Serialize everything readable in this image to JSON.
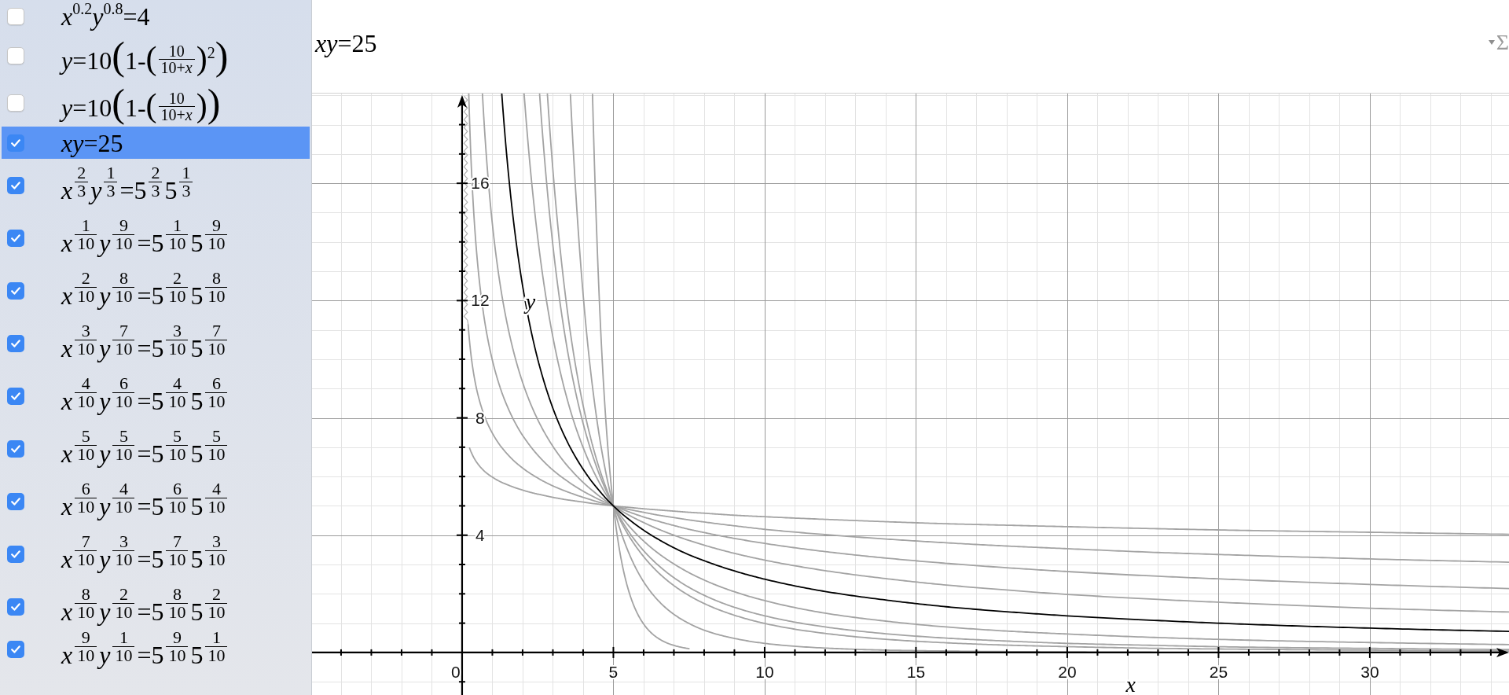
{
  "sidebar": {
    "equations": [
      {
        "checked": false,
        "selected": false,
        "parts": [
          {
            "kind": "text",
            "text": "*x*"
          },
          {
            "kind": "sup",
            "text": "0.2"
          },
          {
            "kind": "text",
            "text": "*y*"
          },
          {
            "kind": "sup",
            "text": "0.8"
          },
          {
            "kind": "text",
            "text": "=4"
          }
        ]
      },
      {
        "checked": false,
        "selected": false,
        "parts": [
          {
            "kind": "text",
            "text": "*y*=10"
          },
          {
            "kind": "bigparen",
            "text": "("
          },
          {
            "kind": "text",
            "text": "1-"
          },
          {
            "kind": "paren",
            "text": "("
          },
          {
            "kind": "frac",
            "num": "10",
            "den": "10+*x*"
          },
          {
            "kind": "paren",
            "text": ")"
          },
          {
            "kind": "sup",
            "text": "2"
          },
          {
            "kind": "bigparen",
            "text": ")"
          }
        ]
      },
      {
        "checked": false,
        "selected": false,
        "parts": [
          {
            "kind": "text",
            "text": "*y*=10"
          },
          {
            "kind": "bigparen",
            "text": "("
          },
          {
            "kind": "text",
            "text": "1-"
          },
          {
            "kind": "paren",
            "text": "("
          },
          {
            "kind": "frac",
            "num": "10",
            "den": "10+*x*"
          },
          {
            "kind": "paren",
            "text": ")"
          },
          {
            "kind": "bigparen",
            "text": ")"
          }
        ]
      },
      {
        "checked": true,
        "selected": true,
        "parts": [
          {
            "kind": "text",
            "text": "*xy*=25"
          }
        ]
      },
      {
        "checked": true,
        "selected": false,
        "parts": [
          {
            "kind": "text",
            "text": "*x*"
          },
          {
            "kind": "supfrac",
            "num": "2",
            "den": "3"
          },
          {
            "kind": "text",
            "text": "*y*"
          },
          {
            "kind": "supfrac",
            "num": "1",
            "den": "3"
          },
          {
            "kind": "text",
            "text": "=5"
          },
          {
            "kind": "supfrac",
            "num": "2",
            "den": "3"
          },
          {
            "kind": "text",
            "text": "5"
          },
          {
            "kind": "supfrac",
            "num": "1",
            "den": "3"
          }
        ]
      },
      {
        "checked": true,
        "selected": false,
        "parts": [
          {
            "kind": "text",
            "text": "*x*"
          },
          {
            "kind": "supfrac",
            "num": "1",
            "den": "10"
          },
          {
            "kind": "text",
            "text": "*y*"
          },
          {
            "kind": "supfrac",
            "num": "9",
            "den": "10"
          },
          {
            "kind": "text",
            "text": "=5"
          },
          {
            "kind": "supfrac",
            "num": "1",
            "den": "10"
          },
          {
            "kind": "text",
            "text": "5"
          },
          {
            "kind": "supfrac",
            "num": "9",
            "den": "10"
          }
        ]
      },
      {
        "checked": true,
        "selected": false,
        "parts": [
          {
            "kind": "text",
            "text": "*x*"
          },
          {
            "kind": "supfrac",
            "num": "2",
            "den": "10"
          },
          {
            "kind": "text",
            "text": "*y*"
          },
          {
            "kind": "supfrac",
            "num": "8",
            "den": "10"
          },
          {
            "kind": "text",
            "text": "=5"
          },
          {
            "kind": "supfrac",
            "num": "2",
            "den": "10"
          },
          {
            "kind": "text",
            "text": "5"
          },
          {
            "kind": "supfrac",
            "num": "8",
            "den": "10"
          }
        ]
      },
      {
        "checked": true,
        "selected": false,
        "parts": [
          {
            "kind": "text",
            "text": "*x*"
          },
          {
            "kind": "supfrac",
            "num": "3",
            "den": "10"
          },
          {
            "kind": "text",
            "text": "*y*"
          },
          {
            "kind": "supfrac",
            "num": "7",
            "den": "10"
          },
          {
            "kind": "text",
            "text": "=5"
          },
          {
            "kind": "supfrac",
            "num": "3",
            "den": "10"
          },
          {
            "kind": "text",
            "text": "5"
          },
          {
            "kind": "supfrac",
            "num": "7",
            "den": "10"
          }
        ]
      },
      {
        "checked": true,
        "selected": false,
        "parts": [
          {
            "kind": "text",
            "text": "*x*"
          },
          {
            "kind": "supfrac",
            "num": "4",
            "den": "10"
          },
          {
            "kind": "text",
            "text": "*y*"
          },
          {
            "kind": "supfrac",
            "num": "6",
            "den": "10"
          },
          {
            "kind": "text",
            "text": "=5"
          },
          {
            "kind": "supfrac",
            "num": "4",
            "den": "10"
          },
          {
            "kind": "text",
            "text": "5"
          },
          {
            "kind": "supfrac",
            "num": "6",
            "den": "10"
          }
        ]
      },
      {
        "checked": true,
        "selected": false,
        "parts": [
          {
            "kind": "text",
            "text": "*x*"
          },
          {
            "kind": "supfrac",
            "num": "5",
            "den": "10"
          },
          {
            "kind": "text",
            "text": "*y*"
          },
          {
            "kind": "supfrac",
            "num": "5",
            "den": "10"
          },
          {
            "kind": "text",
            "text": "=5"
          },
          {
            "kind": "supfrac",
            "num": "5",
            "den": "10"
          },
          {
            "kind": "text",
            "text": "5"
          },
          {
            "kind": "supfrac",
            "num": "5",
            "den": "10"
          }
        ]
      },
      {
        "checked": true,
        "selected": false,
        "parts": [
          {
            "kind": "text",
            "text": "*x*"
          },
          {
            "kind": "supfrac",
            "num": "6",
            "den": "10"
          },
          {
            "kind": "text",
            "text": "*y*"
          },
          {
            "kind": "supfrac",
            "num": "4",
            "den": "10"
          },
          {
            "kind": "text",
            "text": "=5"
          },
          {
            "kind": "supfrac",
            "num": "6",
            "den": "10"
          },
          {
            "kind": "text",
            "text": "5"
          },
          {
            "kind": "supfrac",
            "num": "4",
            "den": "10"
          }
        ]
      },
      {
        "checked": true,
        "selected": false,
        "parts": [
          {
            "kind": "text",
            "text": "*x*"
          },
          {
            "kind": "supfrac",
            "num": "7",
            "den": "10"
          },
          {
            "kind": "text",
            "text": "*y*"
          },
          {
            "kind": "supfrac",
            "num": "3",
            "den": "10"
          },
          {
            "kind": "text",
            "text": "=5"
          },
          {
            "kind": "supfrac",
            "num": "7",
            "den": "10"
          },
          {
            "kind": "text",
            "text": "5"
          },
          {
            "kind": "supfrac",
            "num": "3",
            "den": "10"
          }
        ]
      },
      {
        "checked": true,
        "selected": false,
        "parts": [
          {
            "kind": "text",
            "text": "*x*"
          },
          {
            "kind": "supfrac",
            "num": "8",
            "den": "10"
          },
          {
            "kind": "text",
            "text": "*y*"
          },
          {
            "kind": "supfrac",
            "num": "2",
            "den": "10"
          },
          {
            "kind": "text",
            "text": "=5"
          },
          {
            "kind": "supfrac",
            "num": "8",
            "den": "10"
          },
          {
            "kind": "text",
            "text": "5"
          },
          {
            "kind": "supfrac",
            "num": "2",
            "den": "10"
          }
        ]
      },
      {
        "checked": true,
        "selected": false,
        "parts": [
          {
            "kind": "text",
            "text": "*x*"
          },
          {
            "kind": "supfrac",
            "num": "9",
            "den": "10"
          },
          {
            "kind": "text",
            "text": "*y*"
          },
          {
            "kind": "supfrac",
            "num": "1",
            "den": "10"
          },
          {
            "kind": "text",
            "text": "=5"
          },
          {
            "kind": "supfrac",
            "num": "9",
            "den": "10"
          },
          {
            "kind": "text",
            "text": "5"
          },
          {
            "kind": "supfrac",
            "num": "1",
            "den": "10"
          }
        ]
      }
    ]
  },
  "header": {
    "equation": "*xy*=25",
    "format_menu": {
      "label": "Σ"
    }
  },
  "graph": {
    "chart_data": {
      "type": "line",
      "xlabel": "x",
      "ylabel": "y",
      "x": [
        0.2,
        0.2205,
        0.25,
        0.35,
        0.5,
        0.672,
        0.75,
        1,
        1.25,
        1.3117,
        1.5,
        1.75,
        2,
        2.05,
        2.5,
        2.562,
        2.819,
        3,
        3.5,
        3.58,
        4,
        4.25,
        4.31,
        4.5,
        4.75,
        5,
        5.25,
        5.5,
        6,
        6.5,
        7,
        7.5,
        8,
        9,
        10,
        12,
        14,
        16,
        18,
        20,
        23,
        26,
        30,
        34.6
      ],
      "series": [
        {
          "color": "#000000",
          "values": [
            null,
            null,
            null,
            null,
            null,
            null,
            null,
            null,
            null,
            19.06,
            16.67,
            14.29,
            12.5,
            12.2,
            10,
            9.76,
            8.87,
            8.33,
            7.14,
            6.98,
            6.25,
            5.88,
            5.8,
            5.56,
            5.26,
            5,
            4.76,
            4.55,
            4.17,
            3.85,
            3.57,
            3.33,
            3.13,
            2.78,
            2.5,
            2.08,
            1.79,
            1.56,
            1.39,
            1.25,
            1.09,
            0.96,
            0.83,
            0.72
          ]
        },
        {
          "color": "#a3a3a3",
          "values": [
            null,
            null,
            null,
            null,
            null,
            null,
            null,
            null,
            null,
            null,
            null,
            null,
            null,
            null,
            null,
            19.04,
            15.73,
            13.89,
            10.2,
            9.75,
            7.81,
            6.92,
            6.73,
            6.17,
            5.54,
            5,
            4.54,
            4.13,
            3.47,
            2.96,
            2.55,
            2.22,
            1.95,
            1.54,
            1.25,
            0.87,
            0.64,
            0.49,
            0.39,
            0.31,
            0.24,
            0.18,
            0.14,
            0.1
          ]
        },
        {
          "color": "#a3a3a3",
          "values": [
            null,
            null,
            6.97,
            6.72,
            6.46,
            6.25,
            6.17,
            5.98,
            5.83,
            5.8,
            5.72,
            5.62,
            5.54,
            5.52,
            5.4,
            5.39,
            5.33,
            5.29,
            5.2,
            5.19,
            5.13,
            5.09,
            5.08,
            5.06,
            5.03,
            5,
            4.97,
            4.95,
            4.9,
            4.86,
            4.82,
            4.78,
            4.75,
            4.68,
            4.63,
            4.54,
            4.46,
            4.39,
            4.34,
            4.29,
            4.22,
            4.16,
            4.1,
            4.03
          ]
        },
        {
          "color": "#a3a3a3",
          "values": [
            11.18,
            10.91,
            10.57,
            9.72,
            8.89,
            8.26,
            8.03,
            7.48,
            7.07,
            6.99,
            6.76,
            6.5,
            6.29,
            6.25,
            5.95,
            5.91,
            5.77,
            5.68,
            5.47,
            5.44,
            5.29,
            5.21,
            5.19,
            5.13,
            5.06,
            5,
            4.94,
            4.88,
            4.78,
            4.68,
            4.6,
            4.52,
            4.45,
            4.32,
            4.2,
            4.02,
            3.87,
            3.74,
            3.63,
            3.54,
            3.41,
            3.31,
            3.19,
            3.08
          ]
        },
        {
          "color": "#a3a3a3",
          "values": [
            null,
            19.05,
            18.05,
            15.63,
            13.41,
            11.82,
            11.27,
            9.97,
            9.06,
            8.87,
            8.38,
            7.84,
            7.4,
            7.33,
            6.73,
            6.66,
            6.39,
            6.22,
            5.83,
            5.77,
            5.5,
            5.36,
            5.33,
            5.23,
            5.11,
            5,
            4.9,
            4.8,
            4.62,
            4.47,
            4.33,
            4.2,
            4.09,
            3.89,
            3.72,
            3.44,
            3.22,
            3.04,
            2.89,
            2.76,
            2.6,
            2.47,
            2.32,
            2.18
          ]
        },
        {
          "color": "#a3a3a3",
          "values": [
            null,
            null,
            null,
            null,
            null,
            19.06,
            17.71,
            14.62,
            12.6,
            12.2,
            11.16,
            10.07,
            9.21,
            9.06,
            7.94,
            7.81,
            7.33,
            7.03,
            6.34,
            6.25,
            5.8,
            5.57,
            5.52,
            5.36,
            5.17,
            5,
            4.84,
            4.69,
            4.43,
            4.2,
            4,
            3.82,
            3.66,
            3.38,
            3.15,
            2.79,
            2.52,
            2.3,
            2.13,
            1.98,
            1.81,
            1.67,
            1.51,
            1.38
          ]
        },
        {
          "color": "#a3a3a3",
          "values": [
            null,
            null,
            null,
            null,
            null,
            null,
            null,
            null,
            null,
            null,
            null,
            null,
            null,
            19.05,
            14.14,
            13.63,
            11.81,
            10.76,
            8.54,
            8.25,
            6.99,
            6.38,
            6.25,
            5.86,
            5.4,
            5,
            4.65,
            4.33,
            3.8,
            3.37,
            3.02,
            2.72,
            2.47,
            2.07,
            1.77,
            1.34,
            1.07,
            0.87,
            0.73,
            0.63,
            0.51,
            0.42,
            0.34,
            0.27
          ]
        },
        {
          "color": "#a3a3a3",
          "values": [
            null,
            null,
            null,
            null,
            null,
            null,
            null,
            null,
            null,
            null,
            null,
            null,
            null,
            null,
            null,
            null,
            19.04,
            16.47,
            11.49,
            10.9,
            8.42,
            7.31,
            7.07,
            6.39,
            5.64,
            5,
            4.46,
            4,
            3.27,
            2.71,
            2.28,
            1.94,
            1.67,
            1.27,
            0.99,
            0.65,
            0.45,
            0.33,
            0.25,
            0.2,
            0.14,
            0.11,
            0.08,
            0.05
          ]
        },
        {
          "color": "#a3a3a3",
          "values": [
            null,
            null,
            null,
            null,
            null,
            null,
            null,
            null,
            null,
            null,
            null,
            null,
            null,
            null,
            null,
            null,
            null,
            null,
            null,
            19.02,
            12.21,
            9.58,
            9.06,
            7.62,
            6.14,
            5,
            4.11,
            3.42,
            2.41,
            1.75,
            1.3,
            0.99,
            0.76,
            0.48,
            0.31,
            0.15,
            0.08,
            0.05,
            0.03,
            0.02,
            0.01,
            null,
            null,
            null
          ]
        },
        {
          "color": "#a3a3a3",
          "values": [
            null,
            null,
            null,
            null,
            null,
            null,
            null,
            null,
            null,
            null,
            null,
            null,
            null,
            null,
            null,
            null,
            null,
            null,
            null,
            null,
            null,
            null,
            19.03,
            12.91,
            7.93,
            5,
            3.22,
            2.12,
            0.97,
            0.47,
            0.24,
            0.13,
            null,
            null,
            null,
            null,
            null,
            null,
            null,
            null,
            null,
            null,
            null,
            null
          ]
        }
      ],
      "xlim": [
        -4.96,
        34.6
      ],
      "ylim": [
        -1.45,
        19.06
      ],
      "xticks": [
        0,
        5,
        10,
        15,
        20,
        25,
        30
      ],
      "yticks": [
        4,
        8,
        12,
        16
      ],
      "grid": true
    }
  }
}
